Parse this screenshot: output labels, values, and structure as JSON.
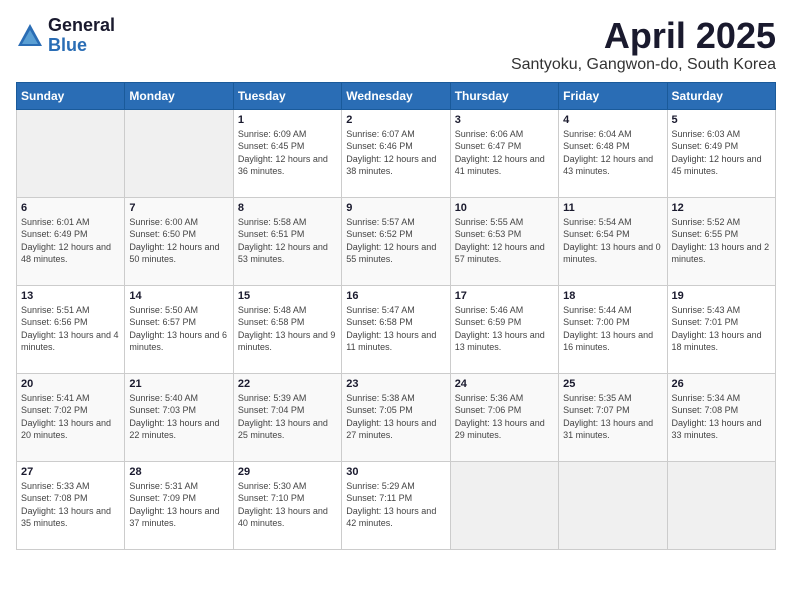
{
  "header": {
    "logo_general": "General",
    "logo_blue": "Blue",
    "month_title": "April 2025",
    "location": "Santyoku, Gangwon-do, South Korea"
  },
  "calendar": {
    "days_of_week": [
      "Sunday",
      "Monday",
      "Tuesday",
      "Wednesday",
      "Thursday",
      "Friday",
      "Saturday"
    ],
    "weeks": [
      [
        {
          "day": "",
          "info": ""
        },
        {
          "day": "",
          "info": ""
        },
        {
          "day": "1",
          "info": "Sunrise: 6:09 AM\nSunset: 6:45 PM\nDaylight: 12 hours and 36 minutes."
        },
        {
          "day": "2",
          "info": "Sunrise: 6:07 AM\nSunset: 6:46 PM\nDaylight: 12 hours and 38 minutes."
        },
        {
          "day": "3",
          "info": "Sunrise: 6:06 AM\nSunset: 6:47 PM\nDaylight: 12 hours and 41 minutes."
        },
        {
          "day": "4",
          "info": "Sunrise: 6:04 AM\nSunset: 6:48 PM\nDaylight: 12 hours and 43 minutes."
        },
        {
          "day": "5",
          "info": "Sunrise: 6:03 AM\nSunset: 6:49 PM\nDaylight: 12 hours and 45 minutes."
        }
      ],
      [
        {
          "day": "6",
          "info": "Sunrise: 6:01 AM\nSunset: 6:49 PM\nDaylight: 12 hours and 48 minutes."
        },
        {
          "day": "7",
          "info": "Sunrise: 6:00 AM\nSunset: 6:50 PM\nDaylight: 12 hours and 50 minutes."
        },
        {
          "day": "8",
          "info": "Sunrise: 5:58 AM\nSunset: 6:51 PM\nDaylight: 12 hours and 53 minutes."
        },
        {
          "day": "9",
          "info": "Sunrise: 5:57 AM\nSunset: 6:52 PM\nDaylight: 12 hours and 55 minutes."
        },
        {
          "day": "10",
          "info": "Sunrise: 5:55 AM\nSunset: 6:53 PM\nDaylight: 12 hours and 57 minutes."
        },
        {
          "day": "11",
          "info": "Sunrise: 5:54 AM\nSunset: 6:54 PM\nDaylight: 13 hours and 0 minutes."
        },
        {
          "day": "12",
          "info": "Sunrise: 5:52 AM\nSunset: 6:55 PM\nDaylight: 13 hours and 2 minutes."
        }
      ],
      [
        {
          "day": "13",
          "info": "Sunrise: 5:51 AM\nSunset: 6:56 PM\nDaylight: 13 hours and 4 minutes."
        },
        {
          "day": "14",
          "info": "Sunrise: 5:50 AM\nSunset: 6:57 PM\nDaylight: 13 hours and 6 minutes."
        },
        {
          "day": "15",
          "info": "Sunrise: 5:48 AM\nSunset: 6:58 PM\nDaylight: 13 hours and 9 minutes."
        },
        {
          "day": "16",
          "info": "Sunrise: 5:47 AM\nSunset: 6:58 PM\nDaylight: 13 hours and 11 minutes."
        },
        {
          "day": "17",
          "info": "Sunrise: 5:46 AM\nSunset: 6:59 PM\nDaylight: 13 hours and 13 minutes."
        },
        {
          "day": "18",
          "info": "Sunrise: 5:44 AM\nSunset: 7:00 PM\nDaylight: 13 hours and 16 minutes."
        },
        {
          "day": "19",
          "info": "Sunrise: 5:43 AM\nSunset: 7:01 PM\nDaylight: 13 hours and 18 minutes."
        }
      ],
      [
        {
          "day": "20",
          "info": "Sunrise: 5:41 AM\nSunset: 7:02 PM\nDaylight: 13 hours and 20 minutes."
        },
        {
          "day": "21",
          "info": "Sunrise: 5:40 AM\nSunset: 7:03 PM\nDaylight: 13 hours and 22 minutes."
        },
        {
          "day": "22",
          "info": "Sunrise: 5:39 AM\nSunset: 7:04 PM\nDaylight: 13 hours and 25 minutes."
        },
        {
          "day": "23",
          "info": "Sunrise: 5:38 AM\nSunset: 7:05 PM\nDaylight: 13 hours and 27 minutes."
        },
        {
          "day": "24",
          "info": "Sunrise: 5:36 AM\nSunset: 7:06 PM\nDaylight: 13 hours and 29 minutes."
        },
        {
          "day": "25",
          "info": "Sunrise: 5:35 AM\nSunset: 7:07 PM\nDaylight: 13 hours and 31 minutes."
        },
        {
          "day": "26",
          "info": "Sunrise: 5:34 AM\nSunset: 7:08 PM\nDaylight: 13 hours and 33 minutes."
        }
      ],
      [
        {
          "day": "27",
          "info": "Sunrise: 5:33 AM\nSunset: 7:08 PM\nDaylight: 13 hours and 35 minutes."
        },
        {
          "day": "28",
          "info": "Sunrise: 5:31 AM\nSunset: 7:09 PM\nDaylight: 13 hours and 37 minutes."
        },
        {
          "day": "29",
          "info": "Sunrise: 5:30 AM\nSunset: 7:10 PM\nDaylight: 13 hours and 40 minutes."
        },
        {
          "day": "30",
          "info": "Sunrise: 5:29 AM\nSunset: 7:11 PM\nDaylight: 13 hours and 42 minutes."
        },
        {
          "day": "",
          "info": ""
        },
        {
          "day": "",
          "info": ""
        },
        {
          "day": "",
          "info": ""
        }
      ]
    ]
  }
}
